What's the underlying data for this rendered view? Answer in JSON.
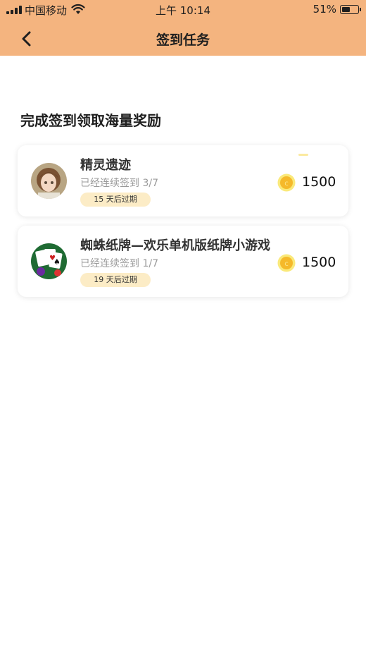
{
  "status_bar": {
    "carrier": "中国移动",
    "time": "上午 10:14",
    "battery": "51%",
    "battery_level": 0.51
  },
  "header": {
    "title": "签到任务",
    "back_icon": "chevron-left-icon"
  },
  "section": {
    "title": "完成签到领取海量奖励"
  },
  "tasks": [
    {
      "name": "精灵遗迹",
      "progress": "已经连续签到 3/7",
      "expire": "15 天后过期",
      "reward": "1500",
      "icon": "coin-icon"
    },
    {
      "name": "蜘蛛纸牌—欢乐单机版纸牌小游戏",
      "progress": "已经连续签到 1/7",
      "expire": "19 天后过期",
      "reward": "1500",
      "icon": "coin-icon"
    }
  ],
  "colors": {
    "header_bg": "#f4b47f",
    "badge_bg": "#fcecc6",
    "coin": "#f7c93a"
  }
}
